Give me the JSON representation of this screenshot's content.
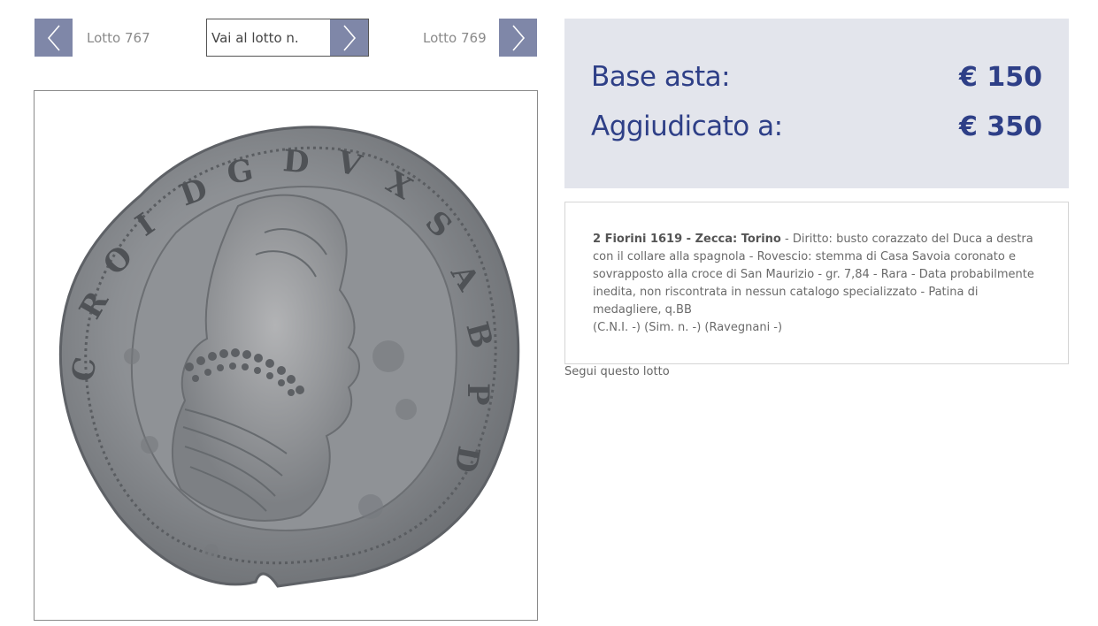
{
  "navigation": {
    "prev_lot_label": "Lotto 767",
    "next_lot_label": "Lotto 769",
    "goto_placeholder": "Vai al lotto n.",
    "prev_icon": "chevron-left-icon",
    "next_icon": "chevron-right-icon",
    "go_icon": "chevron-right-icon"
  },
  "lot_image": {
    "alt": "2 Fiorini 1619 - Zecca: Torino"
  },
  "prices": {
    "base_label": "Base asta:",
    "base_value": "€ 150",
    "awarded_label": "Aggiudicato a:",
    "awarded_value": "€ 350"
  },
  "description": {
    "title": "2 Fiorini 1619 - Zecca: Torino",
    "separator": " - ",
    "body": "Diritto: busto corazzato del Duca a destra con il collare alla spagnola - Rovescio: stemma di Casa Savoia coronato e sovrapposto alla croce di San Maurizio - gr. 7,84 - Rara - Data probabilmente inedita, non riscontrata in nessun catalogo specializzato - Patina di medagliere, q.BB",
    "references": "(C.N.I. -) (Sim. n. -) (Ravegnani -)"
  },
  "follow_label": "Segui questo lotto",
  "colors": {
    "nav_button": "#7f87a8",
    "price_box_bg": "#e3e5ec",
    "price_text": "#2e3f87"
  }
}
